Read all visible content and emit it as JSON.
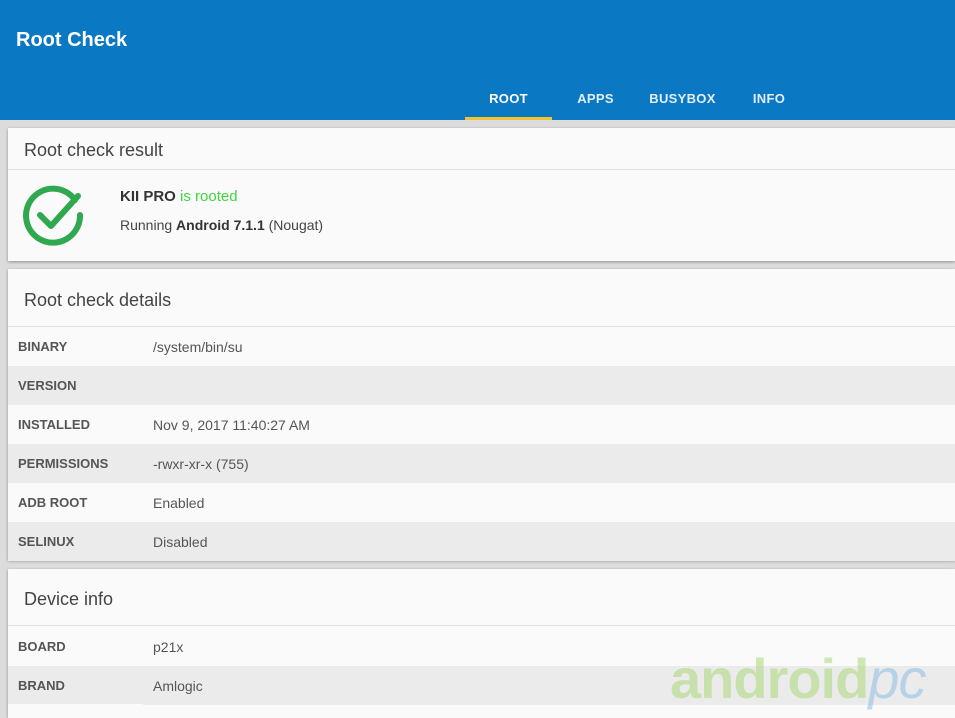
{
  "app": {
    "title": "Root Check",
    "tabs": [
      {
        "label": "ROOT",
        "active": true
      },
      {
        "label": "APPS",
        "active": false
      },
      {
        "label": "BUSYBOX",
        "active": false
      },
      {
        "label": "INFO",
        "active": false
      }
    ],
    "accent_color": "#0a78c2",
    "tab_indicator_color": "#f2c230"
  },
  "result": {
    "title": "Root check result",
    "device": "KII PRO",
    "status": "is rooted",
    "status_color": "#3ed53e",
    "icon": "check-circle-icon",
    "android_prefix": "Running",
    "android_version": "Android 7.1.1",
    "android_codename": "(Nougat)"
  },
  "details": {
    "title": "Root check details",
    "rows": [
      {
        "key": "BINARY",
        "value": "/system/bin/su"
      },
      {
        "key": "VERSION",
        "value": ""
      },
      {
        "key": "INSTALLED",
        "value": "Nov 9, 2017 11:40:27 AM"
      },
      {
        "key": "PERMISSIONS",
        "value": "-rwxr-xr-x (755)"
      },
      {
        "key": "ADB ROOT",
        "value": "Enabled"
      },
      {
        "key": "SELINUX",
        "value": "Disabled"
      }
    ]
  },
  "device_info": {
    "title": "Device info",
    "rows": [
      {
        "key": "BOARD",
        "value": "p21x"
      },
      {
        "key": "BRAND",
        "value": "Amlogic"
      }
    ]
  },
  "watermark": {
    "main": "android",
    "suffix": "pc"
  }
}
